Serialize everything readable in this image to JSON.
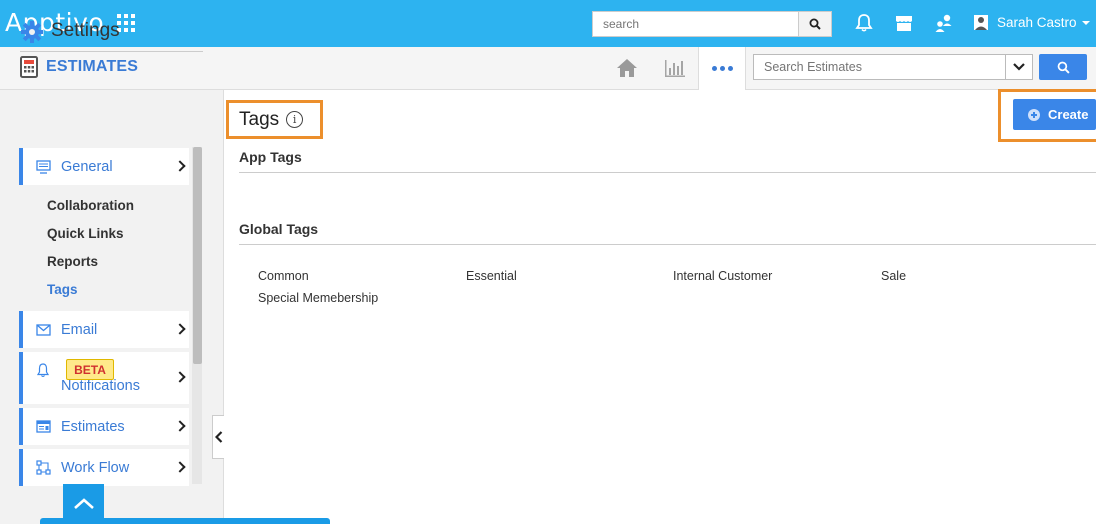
{
  "header": {
    "logo": "Apptivo",
    "search_placeholder": "search",
    "user_name": "Sarah Castro"
  },
  "subheader": {
    "app_title": "ESTIMATES",
    "search_placeholder": "Search Estimates"
  },
  "sidebar": {
    "title": "Settings",
    "general_label": "General",
    "sub_items": [
      "Collaboration",
      "Quick Links",
      "Reports",
      "Tags"
    ],
    "email_label": "Email",
    "beta_badge": "BETA",
    "notifications_label": "Notifications",
    "estimates_label": "Estimates",
    "workflow_label": "Work Flow"
  },
  "main": {
    "title": "Tags",
    "info_glyph": "i",
    "create_label": "Create",
    "app_tags_title": "App Tags",
    "global_tags_title": "Global Tags",
    "global_tags": [
      "Common",
      "Essential",
      "Internal Customer",
      "Sale",
      "Special Memebership"
    ]
  },
  "colors": {
    "topbar": "#2db3f0",
    "accent": "#3a86e8",
    "highlight_border": "#ec8f2c"
  }
}
